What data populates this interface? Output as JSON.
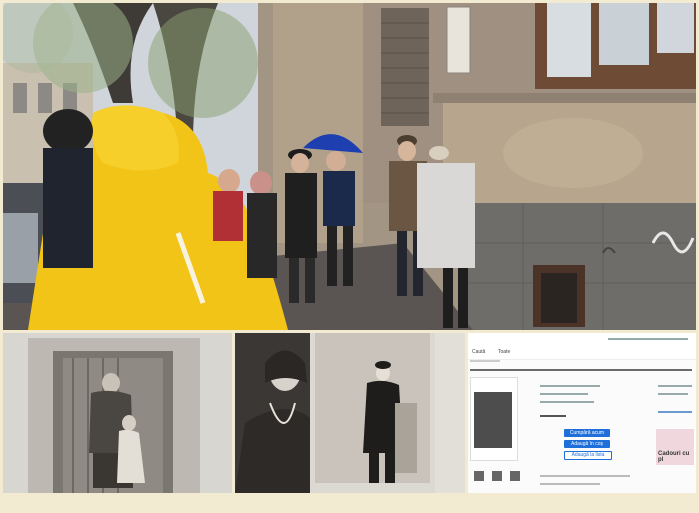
{
  "screenshot": {
    "tab_label": "Caută",
    "nav_label": "Toate",
    "buy_label": "Cumpără acum",
    "add_cart_label": "Adaugă în coș",
    "watch_label": "Adaugă la lista",
    "ad_text": "Cadouri cu pl"
  }
}
